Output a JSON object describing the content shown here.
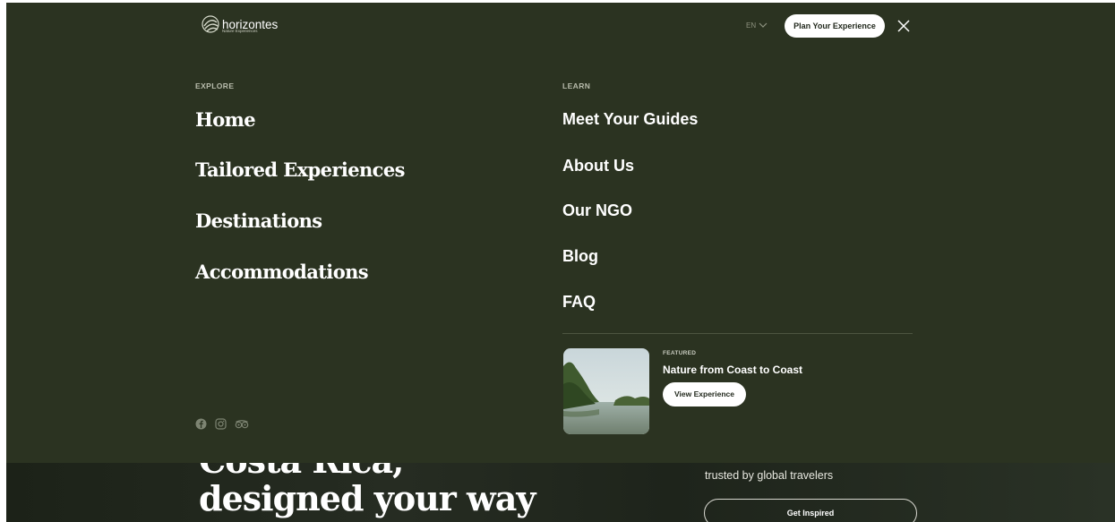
{
  "hero": {
    "title_line1": "Costa Rica,",
    "title_line2": "designed your way",
    "subtitle": "trusted by global travelers",
    "button_label": "Get Inspired"
  },
  "header": {
    "logo_text": "horizontes",
    "logo_tagline": "Nature Experiences",
    "language": "EN",
    "cta_label": "Plan Your Experience"
  },
  "explore": {
    "heading": "EXPLORE",
    "items": [
      "Home",
      "Tailored Experiences",
      "Destinations",
      "Accommodations"
    ]
  },
  "learn": {
    "heading": "LEARN",
    "items": [
      "Meet Your Guides",
      "About Us",
      "Our NGO",
      "Blog",
      "FAQ"
    ]
  },
  "featured": {
    "label": "FEATURED",
    "title": "Nature from Coast to Coast",
    "button_label": "View Experience"
  },
  "socials": [
    "facebook-icon",
    "instagram-icon",
    "tripadvisor-icon"
  ],
  "colors": {
    "menu_bg": "#2b3321",
    "text": "#ffffff",
    "muted": "#b8bcac"
  }
}
